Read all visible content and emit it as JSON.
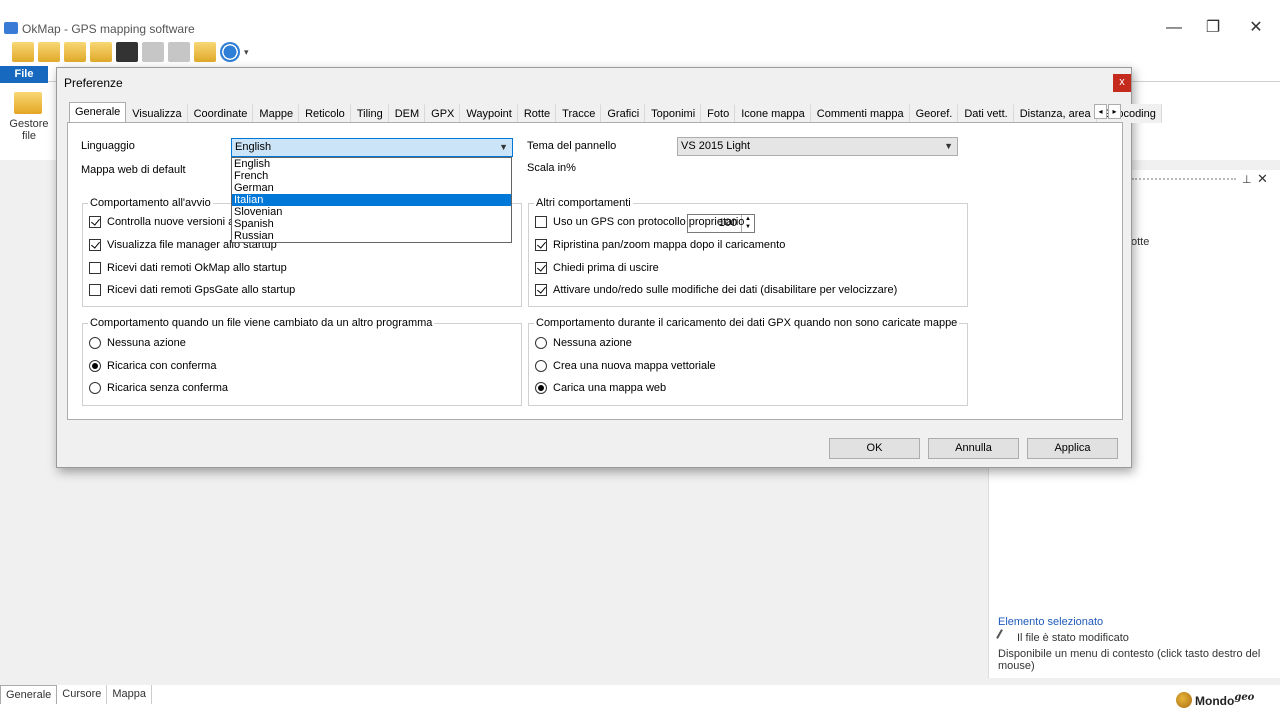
{
  "app": {
    "title": "OkMap - GPS mapping software",
    "file_menu": "File",
    "gestore_label": "Gestore file",
    "window_controls": [
      "—",
      "❐",
      "✕"
    ]
  },
  "right_panel": {
    "partial_text": "otte",
    "selected_title": "Elemento selezionato",
    "modified_text": "Il file è stato modificato",
    "context_text": "Disponibile un menu di contesto (click tasto destro del mouse)"
  },
  "bottom_tabs": [
    "Generale",
    "Cursore",
    "Mappa"
  ],
  "watermark": {
    "text": "Mondo",
    "suffix": "geo"
  },
  "dialog": {
    "title": "Preferenze",
    "close": "x",
    "tabs": [
      "Generale",
      "Visualizza",
      "Coordinate",
      "Mappe",
      "Reticolo",
      "Tiling",
      "DEM",
      "GPX",
      "Waypoint",
      "Rotte",
      "Tracce",
      "Grafici",
      "Toponimi",
      "Foto",
      "Icone mappa",
      "Commenti mappa",
      "Georef.",
      "Dati vett.",
      "Distanza, area",
      "Geocoding"
    ],
    "tab_arrows": [
      "◂",
      "▸"
    ],
    "language_label": "Linguaggio",
    "language_value": "English",
    "language_options": [
      "English",
      "French",
      "German",
      "Italian",
      "Slovenian",
      "Spanish",
      "Russian"
    ],
    "language_highlighted": "Italian",
    "webmap_label": "Mappa web di default",
    "theme_label": "Tema del pannello",
    "theme_value": "VS 2015 Light",
    "scale_label": "Scala in%",
    "scale_value": "100",
    "startup_group": {
      "title": "Comportamento all'avvio",
      "items": [
        {
          "label": "Controlla nuove versioni allo startup",
          "checked": true
        },
        {
          "label": "Visualizza file manager allo startup",
          "checked": true
        },
        {
          "label": "Ricevi dati remoti OkMap allo startup",
          "checked": false
        },
        {
          "label": "Ricevi dati remoti GpsGate allo startup",
          "checked": false
        }
      ]
    },
    "other_group": {
      "title": "Altri comportamenti",
      "items": [
        {
          "label": "Uso un GPS con protocollo proprietario",
          "checked": false
        },
        {
          "label": "Ripristina pan/zoom mappa dopo il caricamento",
          "checked": true
        },
        {
          "label": "Chiedi prima di uscire",
          "checked": true
        },
        {
          "label": "Attivare undo/redo sulle modifiche dei dati (disabilitare per velocizzare)",
          "checked": true
        }
      ]
    },
    "filechange_group": {
      "title": "Comportamento quando un file viene cambiato da un altro programma",
      "items": [
        {
          "label": "Nessuna azione",
          "selected": false
        },
        {
          "label": "Ricarica con conferma",
          "selected": true
        },
        {
          "label": "Ricarica senza conferma",
          "selected": false
        }
      ]
    },
    "gpxload_group": {
      "title": "Comportamento durante il caricamento dei dati GPX quando non sono caricate mappe",
      "items": [
        {
          "label": "Nessuna azione",
          "selected": false
        },
        {
          "label": "Crea una nuova mappa vettoriale",
          "selected": false
        },
        {
          "label": "Carica una mappa web",
          "selected": true
        }
      ]
    },
    "buttons": {
      "ok": "OK",
      "cancel": "Annulla",
      "apply": "Applica"
    }
  }
}
